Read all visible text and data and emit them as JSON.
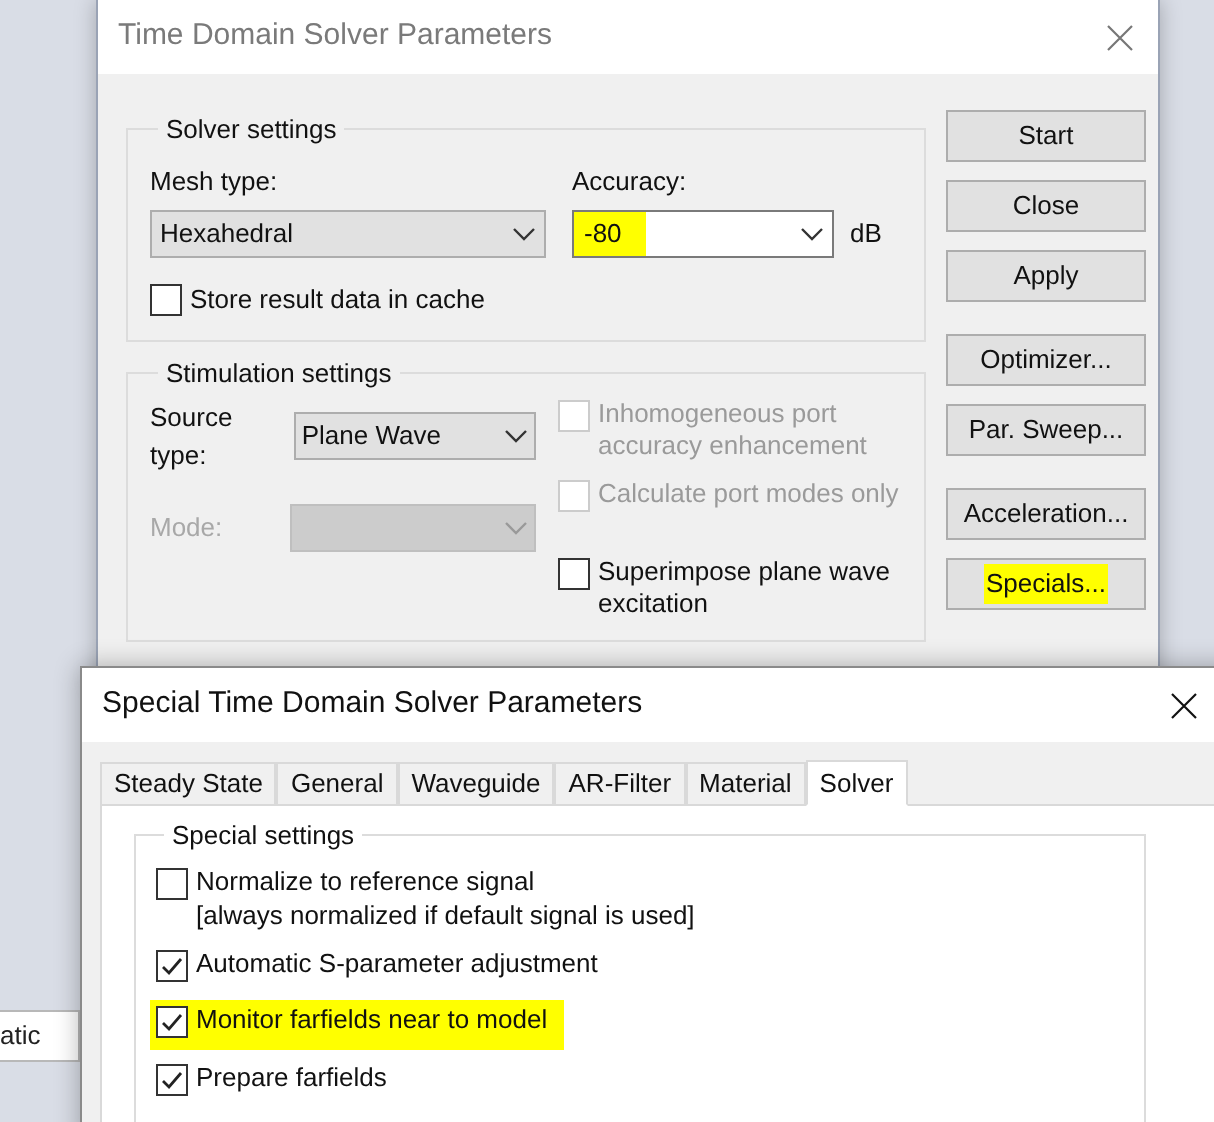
{
  "background_window": {
    "text": "atic"
  },
  "main_dialog": {
    "title": "Time Domain Solver Parameters",
    "solver_settings": {
      "title": "Solver settings",
      "mesh_type": {
        "label": "Mesh type:",
        "value": "Hexahedral"
      },
      "accuracy": {
        "label": "Accuracy:",
        "value": "-80",
        "unit": "dB",
        "highlighted": true
      },
      "cache": {
        "label": "Store result data in cache",
        "checked": false
      }
    },
    "stimulation_settings": {
      "title": "Stimulation settings",
      "source_type": {
        "label": "Source type:",
        "value": "Plane Wave"
      },
      "mode": {
        "label": "Mode:",
        "disabled": true
      },
      "options": [
        {
          "label": "Inhomogeneous port accuracy enhancement",
          "checked": false,
          "disabled": true
        },
        {
          "label": "Calculate port modes only",
          "checked": false,
          "disabled": true
        },
        {
          "label": "Superimpose plane wave excitation",
          "checked": false,
          "disabled": false
        }
      ]
    },
    "button_groups": [
      [
        {
          "label": "Start",
          "highlighted": false
        },
        {
          "label": "Close",
          "highlighted": false
        },
        {
          "label": "Apply",
          "highlighted": false
        }
      ],
      [
        {
          "label": "Optimizer...",
          "highlighted": false
        },
        {
          "label": "Par. Sweep...",
          "highlighted": false
        }
      ],
      [
        {
          "label": "Acceleration...",
          "highlighted": false
        },
        {
          "label": "Specials...",
          "highlighted": true
        }
      ]
    ]
  },
  "special_dialog": {
    "title": "Special Time Domain Solver Parameters",
    "tabs": [
      {
        "label": "Steady State",
        "selected": false
      },
      {
        "label": "General",
        "selected": false
      },
      {
        "label": "Waveguide",
        "selected": false
      },
      {
        "label": "AR-Filter",
        "selected": false
      },
      {
        "label": "Material",
        "selected": false
      },
      {
        "label": "Solver",
        "selected": true
      }
    ],
    "group": {
      "title": "Special settings",
      "options": [
        {
          "label": "Normalize to reference signal",
          "note": "[always normalized if default signal is used]",
          "checked": false,
          "highlighted": false
        },
        {
          "label": "Automatic S-parameter adjustment",
          "checked": true,
          "highlighted": false
        },
        {
          "label": "Monitor farfields near to model",
          "checked": true,
          "highlighted": true
        },
        {
          "label": "Prepare farfields",
          "checked": true,
          "highlighted": false
        }
      ]
    }
  }
}
